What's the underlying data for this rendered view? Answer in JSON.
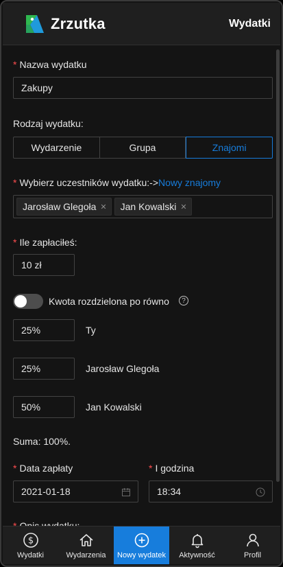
{
  "header": {
    "app_name": "Zrzutka",
    "section": "Wydatki"
  },
  "form": {
    "name_label": "Nazwa wydatku",
    "name_value": "Zakupy",
    "type_label": "Rodzaj wydatku:",
    "type_options": [
      "Wydarzenie",
      "Grupa",
      "Znajomi"
    ],
    "type_selected": "Znajomi",
    "participants_label": "Wybierz uczestników wydatku:->",
    "participants_link": "Nowy znajomy",
    "participants": [
      "Jarosław Glegoła",
      "Jan Kowalski"
    ],
    "paid_label": "Ile zapłaciłeś:",
    "paid_value": "10 zł",
    "split_switch_label": "Kwota rozdzielona po równo",
    "split_switch_on": false,
    "shares": [
      {
        "percent": "25%",
        "person": "Ty"
      },
      {
        "percent": "25%",
        "person": "Jarosław Glegoła"
      },
      {
        "percent": "50%",
        "person": "Jan Kowalski"
      }
    ],
    "sum_text": "Suma: 100%.",
    "date_label": "Data zapłaty",
    "date_value": "2021-01-18",
    "time_label": "I godzina",
    "time_value": "18:34",
    "description_label": "Opis wydatku:"
  },
  "nav": {
    "items": [
      {
        "label": "Wydatki",
        "icon": "dollar-icon"
      },
      {
        "label": "Wydarzenia",
        "icon": "home-icon"
      },
      {
        "label": "Nowy wydatek",
        "icon": "plus-circle-icon"
      },
      {
        "label": "Aktywność",
        "icon": "bell-icon"
      },
      {
        "label": "Profil",
        "icon": "user-icon"
      }
    ],
    "active": "Nowy wydatek"
  },
  "colors": {
    "primary": "#177ddc",
    "required": "#ff4d4f",
    "background": "#141414",
    "header": "#1f1f1f"
  }
}
